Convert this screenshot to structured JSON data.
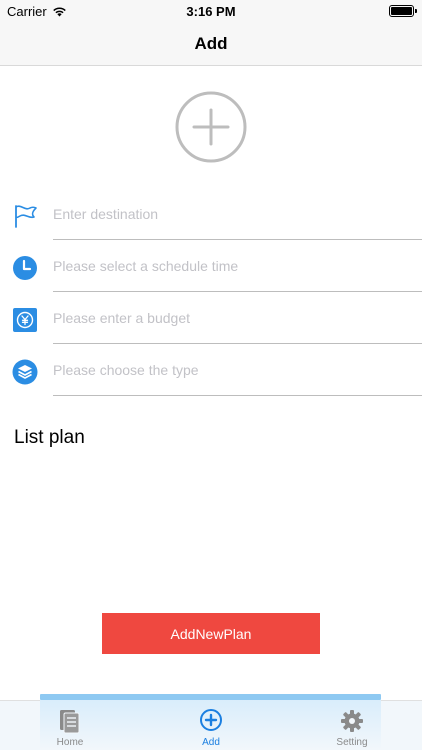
{
  "status_bar": {
    "carrier": "Carrier",
    "time": "3:16 PM"
  },
  "nav": {
    "title": "Add"
  },
  "form": {
    "fields": [
      {
        "placeholder": "Enter destination",
        "icon": "flag-icon"
      },
      {
        "placeholder": "Please select a schedule time",
        "icon": "clock-icon"
      },
      {
        "placeholder": "Please enter a budget",
        "icon": "yen-icon"
      },
      {
        "placeholder": "Please choose the type",
        "icon": "layers-icon"
      }
    ]
  },
  "list": {
    "title": "List plan"
  },
  "actions": {
    "add_label": "AddNewPlan"
  },
  "tabs": [
    {
      "label": "Home",
      "icon": "document-icon"
    },
    {
      "label": "Add",
      "icon": "plus-circle-icon"
    },
    {
      "label": "Setting",
      "icon": "gear-icon"
    }
  ],
  "colors": {
    "accent": "#1b7fe0",
    "button": "#ef4840",
    "icon_blue": "#2b8de3"
  }
}
